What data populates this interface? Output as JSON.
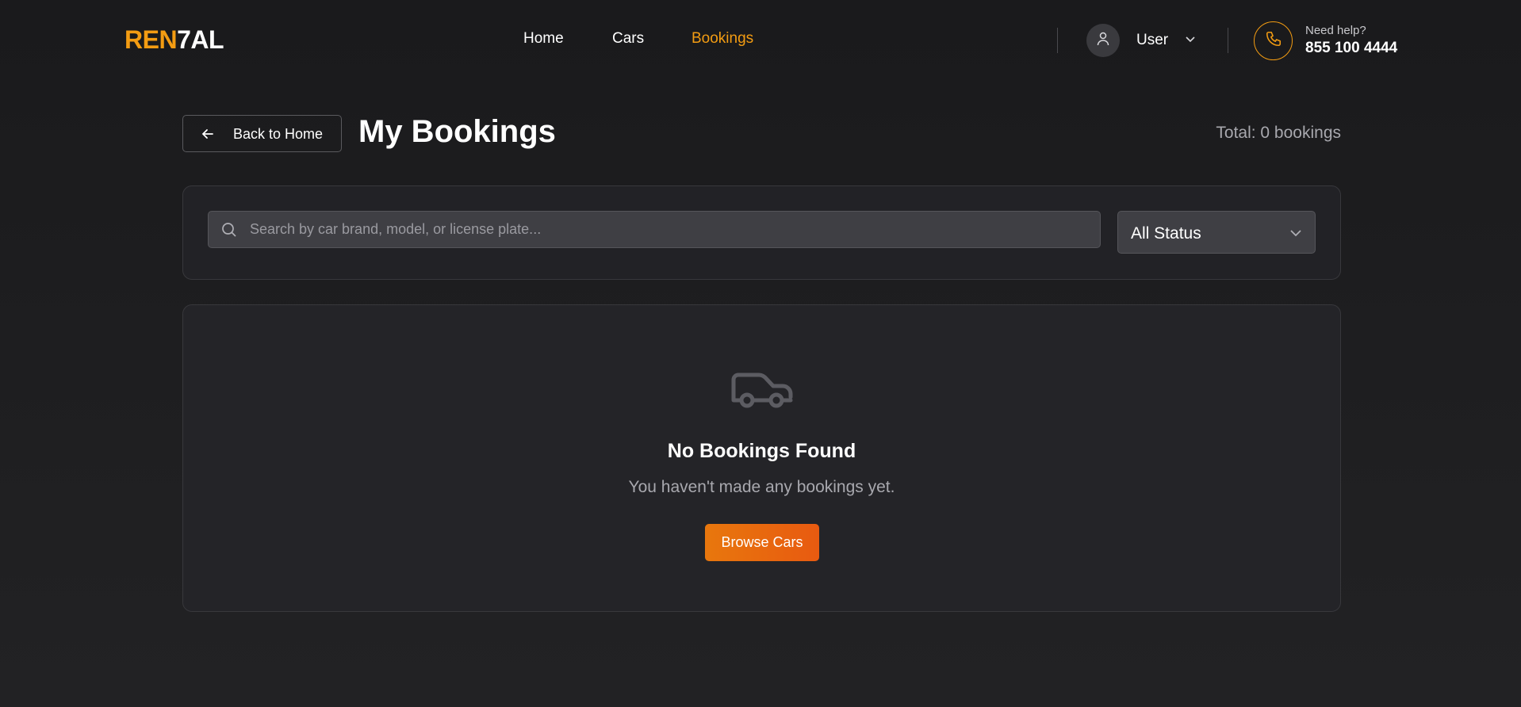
{
  "brand": {
    "logo_part1": "REN",
    "logo_part2": "7AL"
  },
  "nav": {
    "home": "Home",
    "cars": "Cars",
    "bookings": "Bookings"
  },
  "user": {
    "label": "User"
  },
  "help": {
    "label": "Need help?",
    "phone": "855 100 4444"
  },
  "page": {
    "back_label": "Back to Home",
    "title": "My Bookings",
    "total": "Total: 0 bookings"
  },
  "filters": {
    "search_placeholder": "Search by car brand, model, or license plate...",
    "search_value": "",
    "status_selected": "All Status"
  },
  "empty": {
    "title": "No Bookings Found",
    "subtitle": "You haven't made any bookings yet.",
    "cta": "Browse Cars"
  },
  "colors": {
    "accent": "#f39c12",
    "cta_start": "#e8770d",
    "cta_end": "#e85a10",
    "background": "#1c1c1e",
    "panel": "#242428"
  },
  "icons": [
    "user-icon",
    "chevron-down-icon",
    "phone-icon",
    "arrow-left-icon",
    "search-icon",
    "car-icon"
  ]
}
